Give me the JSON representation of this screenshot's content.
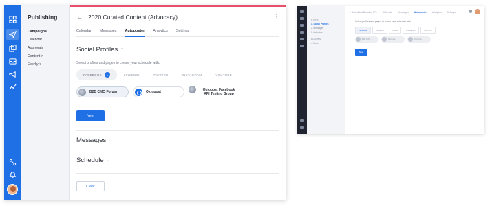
{
  "left_app": {
    "rail_icons": [
      "dashboard-icon",
      "publish-icon",
      "copy-icon",
      "inbox-icon",
      "megaphone-icon",
      "analytics-icon",
      "share-icon",
      "bell-icon",
      "user-avatar"
    ],
    "subnav": {
      "title": "Publishing",
      "items": [
        {
          "label": "Campaigns",
          "bold": true
        },
        {
          "label": "Calendar",
          "bold": false
        },
        {
          "label": "Approvals",
          "bold": false
        },
        {
          "label": "Content >",
          "bold": false
        },
        {
          "label": "Feedly >",
          "bold": false
        }
      ]
    },
    "header": {
      "back_icon": "←",
      "title": "2020 Curated Content (Advocacy)",
      "menu_icon": "⋮"
    },
    "tabs": [
      "Calendar",
      "Messages",
      "Autoposter",
      "Analytics",
      "Settings"
    ],
    "active_tab": "Autoposter",
    "social_profiles": {
      "title": "Social Profiles",
      "chevron": "⌃",
      "hint": "Select profiles and pages to create your schedule with.",
      "networks": [
        {
          "label": "FACEBOOK",
          "badge": "1",
          "active": true
        },
        {
          "label": "LINKEDIN",
          "active": false
        },
        {
          "label": "TWITTER",
          "active": false
        },
        {
          "label": "INSTAGRAM",
          "active": false
        },
        {
          "label": "YOUTUBE",
          "active": false
        }
      ],
      "pages": [
        {
          "label": "B2B CMO Forum",
          "selected": true
        },
        {
          "label": "Oktopost",
          "selected": false
        },
        {
          "label": "Oktopost Facebook API Testing Group",
          "selected": false
        }
      ],
      "next_button": "Next"
    },
    "messages_section": {
      "title": "Messages",
      "chevron": "⌄"
    },
    "schedule_section": {
      "title": "Schedule",
      "chevron": "⌄"
    },
    "clear_button": "Clear",
    "accent_color": "#1f6fe5"
  },
  "right_app": {
    "topbar": [
      "< Scheduled Boosting 07...",
      "Calendar",
      "Messages",
      "Autoposter",
      "Analytics",
      "Settings"
    ],
    "active_tab": "Autoposter",
    "subnav": [
      {
        "label": "STEPS",
        "active": false
      },
      {
        "label": "1. Social Profiles",
        "active": true
      },
      {
        "label": "2. Messages",
        "active": false
      },
      {
        "label": "3. Schedule",
        "active": false
      },
      {
        "label": "ACTIONS",
        "active": false
      },
      {
        "label": "⊙ Reset",
        "active": false
      }
    ],
    "hint": "Select profiles and pages to create your schedule with.",
    "networks": [
      {
        "label": "Facebook",
        "active": true
      },
      {
        "label": "LinkedIn",
        "active": false
      },
      {
        "label": "Twitter",
        "active": false
      },
      {
        "label": "Instagram",
        "active": false
      },
      {
        "label": "YouTube",
        "active": false
      }
    ],
    "pages": [
      "B2B CMO...",
      "Oktopost",
      "Oktopost..."
    ],
    "next_button": "Next"
  }
}
